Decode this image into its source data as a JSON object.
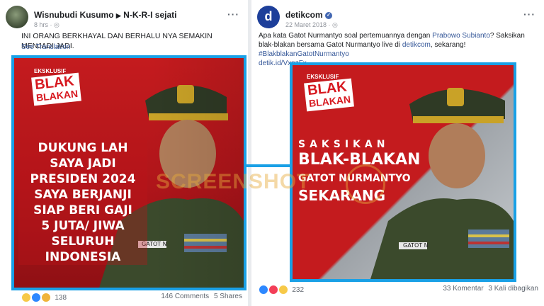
{
  "left_post": {
    "author": "Wisnubudi Kusumo",
    "group": "N-K-R-I sejati",
    "time": "8 hrs",
    "text": "INI ORANG BERKHAYAL DAN BERHALU NYA SEMAKIN MENJADI JADI.",
    "translate": "See Translation",
    "image": {
      "kicker": "EKSKLUSIF",
      "badge_line1": "BLAK",
      "badge_line2": "BLAKAN",
      "overlay": [
        "DUKUNG LAH",
        "SAYA JADI",
        "PRESIDEN 2024",
        "SAYA BERJANJI",
        "SIAP BERI GAJI",
        "5 JUTA/ JIWA",
        "SELURUH",
        "INDONESIA"
      ],
      "nametag": "GATOT N"
    },
    "reactions_count": "138",
    "comments": "146 Comments",
    "shares": "5 Shares"
  },
  "right_post": {
    "author": "detikcom",
    "date": "22 Maret 2018",
    "text_prefix": "Apa kata Gatot Nurmantyo soal pertemuannya dengan ",
    "mention": "Prabowo Subianto",
    "text_mid": "? Saksikan blak-blakan bersama Gatot Nurmantyo live di ",
    "mention2": "detikcom",
    "text_mid2": ", sekarang! ",
    "hashtag": "#BlakblakanGatotNurmantyo",
    "url": "detik.id/VxpzFx",
    "image": {
      "kicker": "EKSKLUSIF",
      "badge_line1": "BLAK",
      "badge_line2": "BLAKAN",
      "overlay": [
        "SAKSIKAN",
        "BLAK-BLAKAN",
        "GATOT NURMANTYO",
        "SEKARANG"
      ],
      "nametag": "GATOT N"
    },
    "reactions_count": "232",
    "comments": "33 Komentar",
    "shares": "3 Kali dibagikan"
  },
  "watermark": "SCREENSHOT",
  "colors": {
    "frame": "#19a0e6",
    "red": "#d71920",
    "link": "#365899"
  }
}
